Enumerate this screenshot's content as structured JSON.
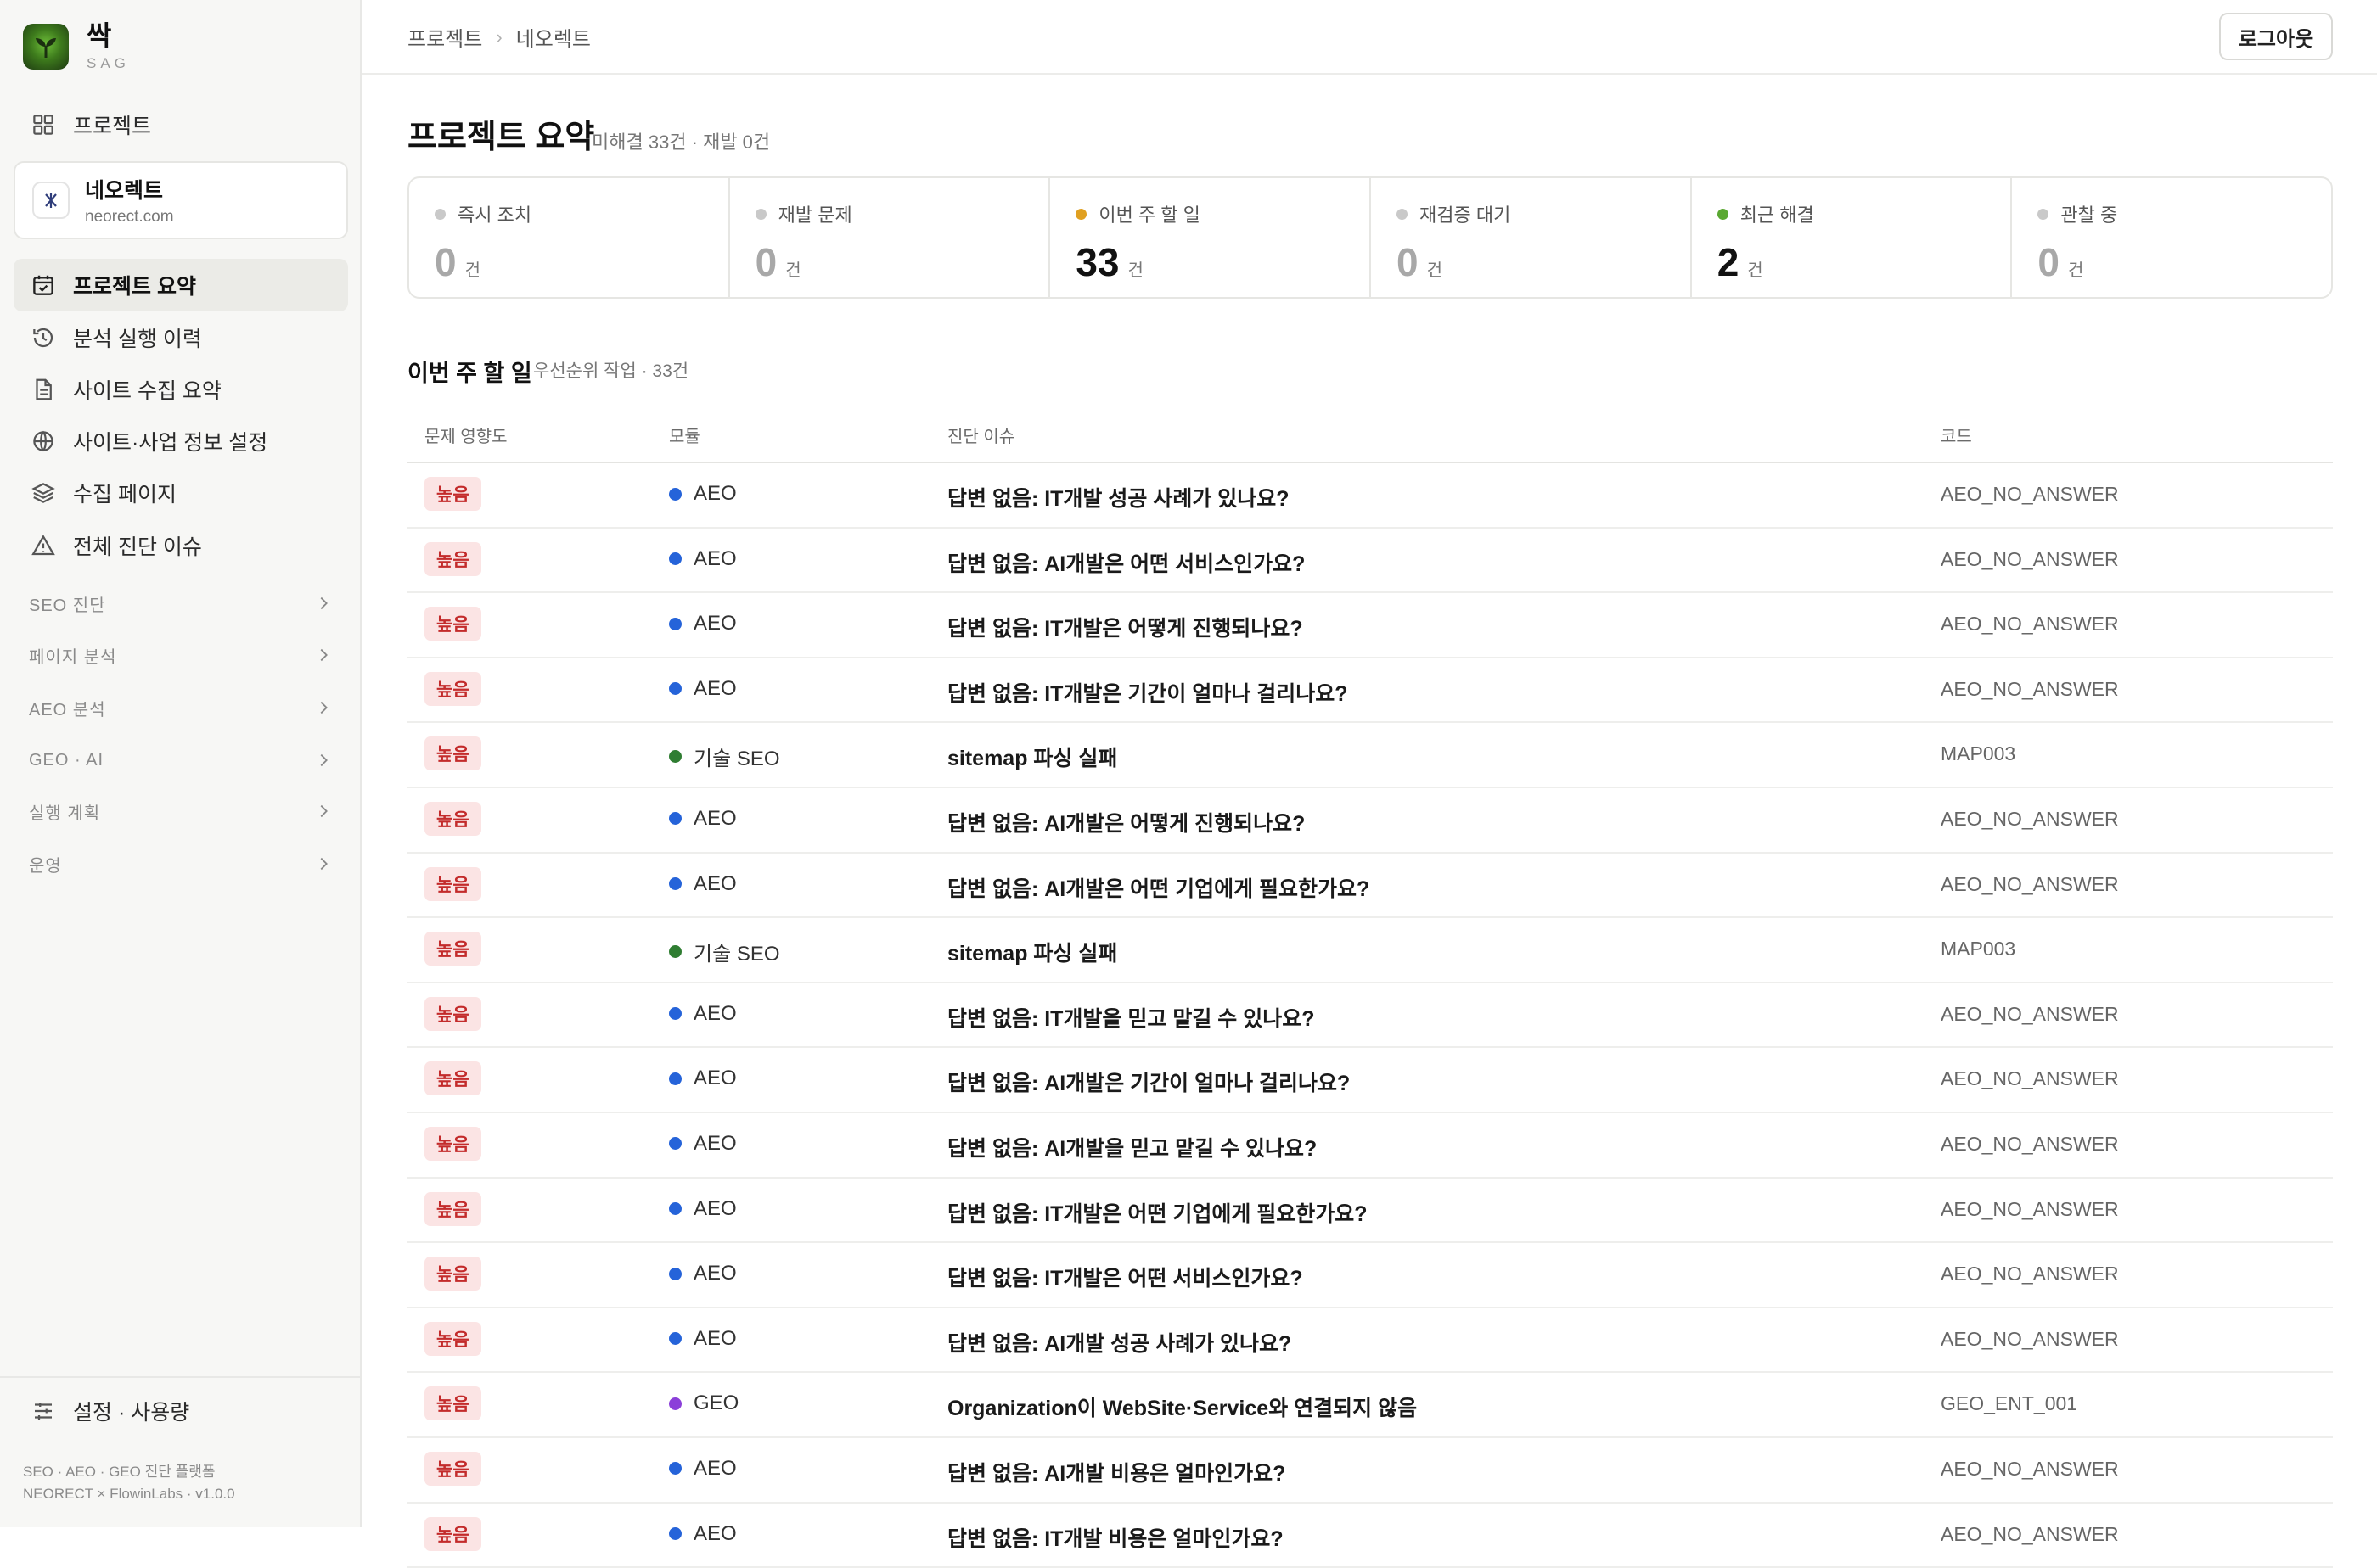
{
  "app": {
    "name": "싹",
    "sub": "SAG"
  },
  "sidebar": {
    "projects_label": "프로젝트",
    "project": {
      "name": "네오렉트",
      "domain": "neorect.com"
    },
    "nav": [
      {
        "label": "프로젝트 요약",
        "icon": "calendar-check-icon",
        "active": true
      },
      {
        "label": "분석 실행 이력",
        "icon": "history-icon",
        "active": false
      },
      {
        "label": "사이트 수집 요약",
        "icon": "document-icon",
        "active": false
      },
      {
        "label": "사이트·사업 정보 설정",
        "icon": "globe-icon",
        "active": false
      },
      {
        "label": "수집 페이지",
        "icon": "layers-icon",
        "active": false
      },
      {
        "label": "전체 진단 이슈",
        "icon": "warning-icon",
        "active": false
      }
    ],
    "sections": [
      {
        "label": "SEO 진단"
      },
      {
        "label": "페이지 분석"
      },
      {
        "label": "AEO 분석"
      },
      {
        "label": "GEO · AI"
      },
      {
        "label": "실행 계획"
      },
      {
        "label": "운영"
      }
    ],
    "settings_label": "설정 · 사용량",
    "footer_line1": "SEO · AEO · GEO 진단 플랫폼",
    "footer_line2": "NEORECT × FlowinLabs · v1.0.0"
  },
  "header": {
    "breadcrumb": [
      "프로젝트",
      "네오렉트"
    ],
    "breadcrumb_sep": "›",
    "logout_label": "로그아웃"
  },
  "summary": {
    "title": "프로젝트 요약",
    "subtitle": "미해결 33건 · 재발 0건",
    "unit": "건",
    "stats": [
      {
        "label": "즉시 조치",
        "value": "0",
        "dot_color": "#c9c9c9",
        "value_color": "#a8a8a8"
      },
      {
        "label": "재발 문제",
        "value": "0",
        "dot_color": "#c9c9c9",
        "value_color": "#a8a8a8"
      },
      {
        "label": "이번 주 할 일",
        "value": "33",
        "dot_color": "#e0a021",
        "value_color": "#111111"
      },
      {
        "label": "재검증 대기",
        "value": "0",
        "dot_color": "#c9c9c9",
        "value_color": "#a8a8a8"
      },
      {
        "label": "최근 해결",
        "value": "2",
        "dot_color": "#5aa832",
        "value_color": "#111111"
      },
      {
        "label": "관찰 중",
        "value": "0",
        "dot_color": "#c9c9c9",
        "value_color": "#a8a8a8"
      }
    ]
  },
  "tasks": {
    "title": "이번 주 할 일",
    "subtitle": "우선순위 작업 · 33건",
    "columns": [
      "문제 영향도",
      "모듈",
      "진단 이슈",
      "코드"
    ],
    "module_colors": {
      "AEO": "#2563d9",
      "기술 SEO": "#2f7d32",
      "GEO": "#8b3fd9"
    },
    "rows": [
      {
        "impact": "높음",
        "module": "AEO",
        "issue": "답변 없음: IT개발 성공 사례가 있나요?",
        "code": "AEO_NO_ANSWER"
      },
      {
        "impact": "높음",
        "module": "AEO",
        "issue": "답변 없음: AI개발은 어떤 서비스인가요?",
        "code": "AEO_NO_ANSWER"
      },
      {
        "impact": "높음",
        "module": "AEO",
        "issue": "답변 없음: IT개발은 어떻게 진행되나요?",
        "code": "AEO_NO_ANSWER"
      },
      {
        "impact": "높음",
        "module": "AEO",
        "issue": "답변 없음: IT개발은 기간이 얼마나 걸리나요?",
        "code": "AEO_NO_ANSWER"
      },
      {
        "impact": "높음",
        "module": "기술 SEO",
        "issue": "sitemap 파싱 실패",
        "code": "MAP003"
      },
      {
        "impact": "높음",
        "module": "AEO",
        "issue": "답변 없음: AI개발은 어떻게 진행되나요?",
        "code": "AEO_NO_ANSWER"
      },
      {
        "impact": "높음",
        "module": "AEO",
        "issue": "답변 없음: AI개발은 어떤 기업에게 필요한가요?",
        "code": "AEO_NO_ANSWER"
      },
      {
        "impact": "높음",
        "module": "기술 SEO",
        "issue": "sitemap 파싱 실패",
        "code": "MAP003"
      },
      {
        "impact": "높음",
        "module": "AEO",
        "issue": "답변 없음: IT개발을 믿고 맡길 수 있나요?",
        "code": "AEO_NO_ANSWER"
      },
      {
        "impact": "높음",
        "module": "AEO",
        "issue": "답변 없음: AI개발은 기간이 얼마나 걸리나요?",
        "code": "AEO_NO_ANSWER"
      },
      {
        "impact": "높음",
        "module": "AEO",
        "issue": "답변 없음: AI개발을 믿고 맡길 수 있나요?",
        "code": "AEO_NO_ANSWER"
      },
      {
        "impact": "높음",
        "module": "AEO",
        "issue": "답변 없음: IT개발은 어떤 기업에게 필요한가요?",
        "code": "AEO_NO_ANSWER"
      },
      {
        "impact": "높음",
        "module": "AEO",
        "issue": "답변 없음: IT개발은 어떤 서비스인가요?",
        "code": "AEO_NO_ANSWER"
      },
      {
        "impact": "높음",
        "module": "AEO",
        "issue": "답변 없음: AI개발 성공 사례가 있나요?",
        "code": "AEO_NO_ANSWER"
      },
      {
        "impact": "높음",
        "module": "GEO",
        "issue": "Organization이 WebSite·Service와 연결되지 않음",
        "code": "GEO_ENT_001"
      },
      {
        "impact": "높음",
        "module": "AEO",
        "issue": "답변 없음: AI개발 비용은 얼마인가요?",
        "code": "AEO_NO_ANSWER"
      },
      {
        "impact": "높음",
        "module": "AEO",
        "issue": "답변 없음: IT개발 비용은 얼마인가요?",
        "code": "AEO_NO_ANSWER"
      }
    ]
  }
}
